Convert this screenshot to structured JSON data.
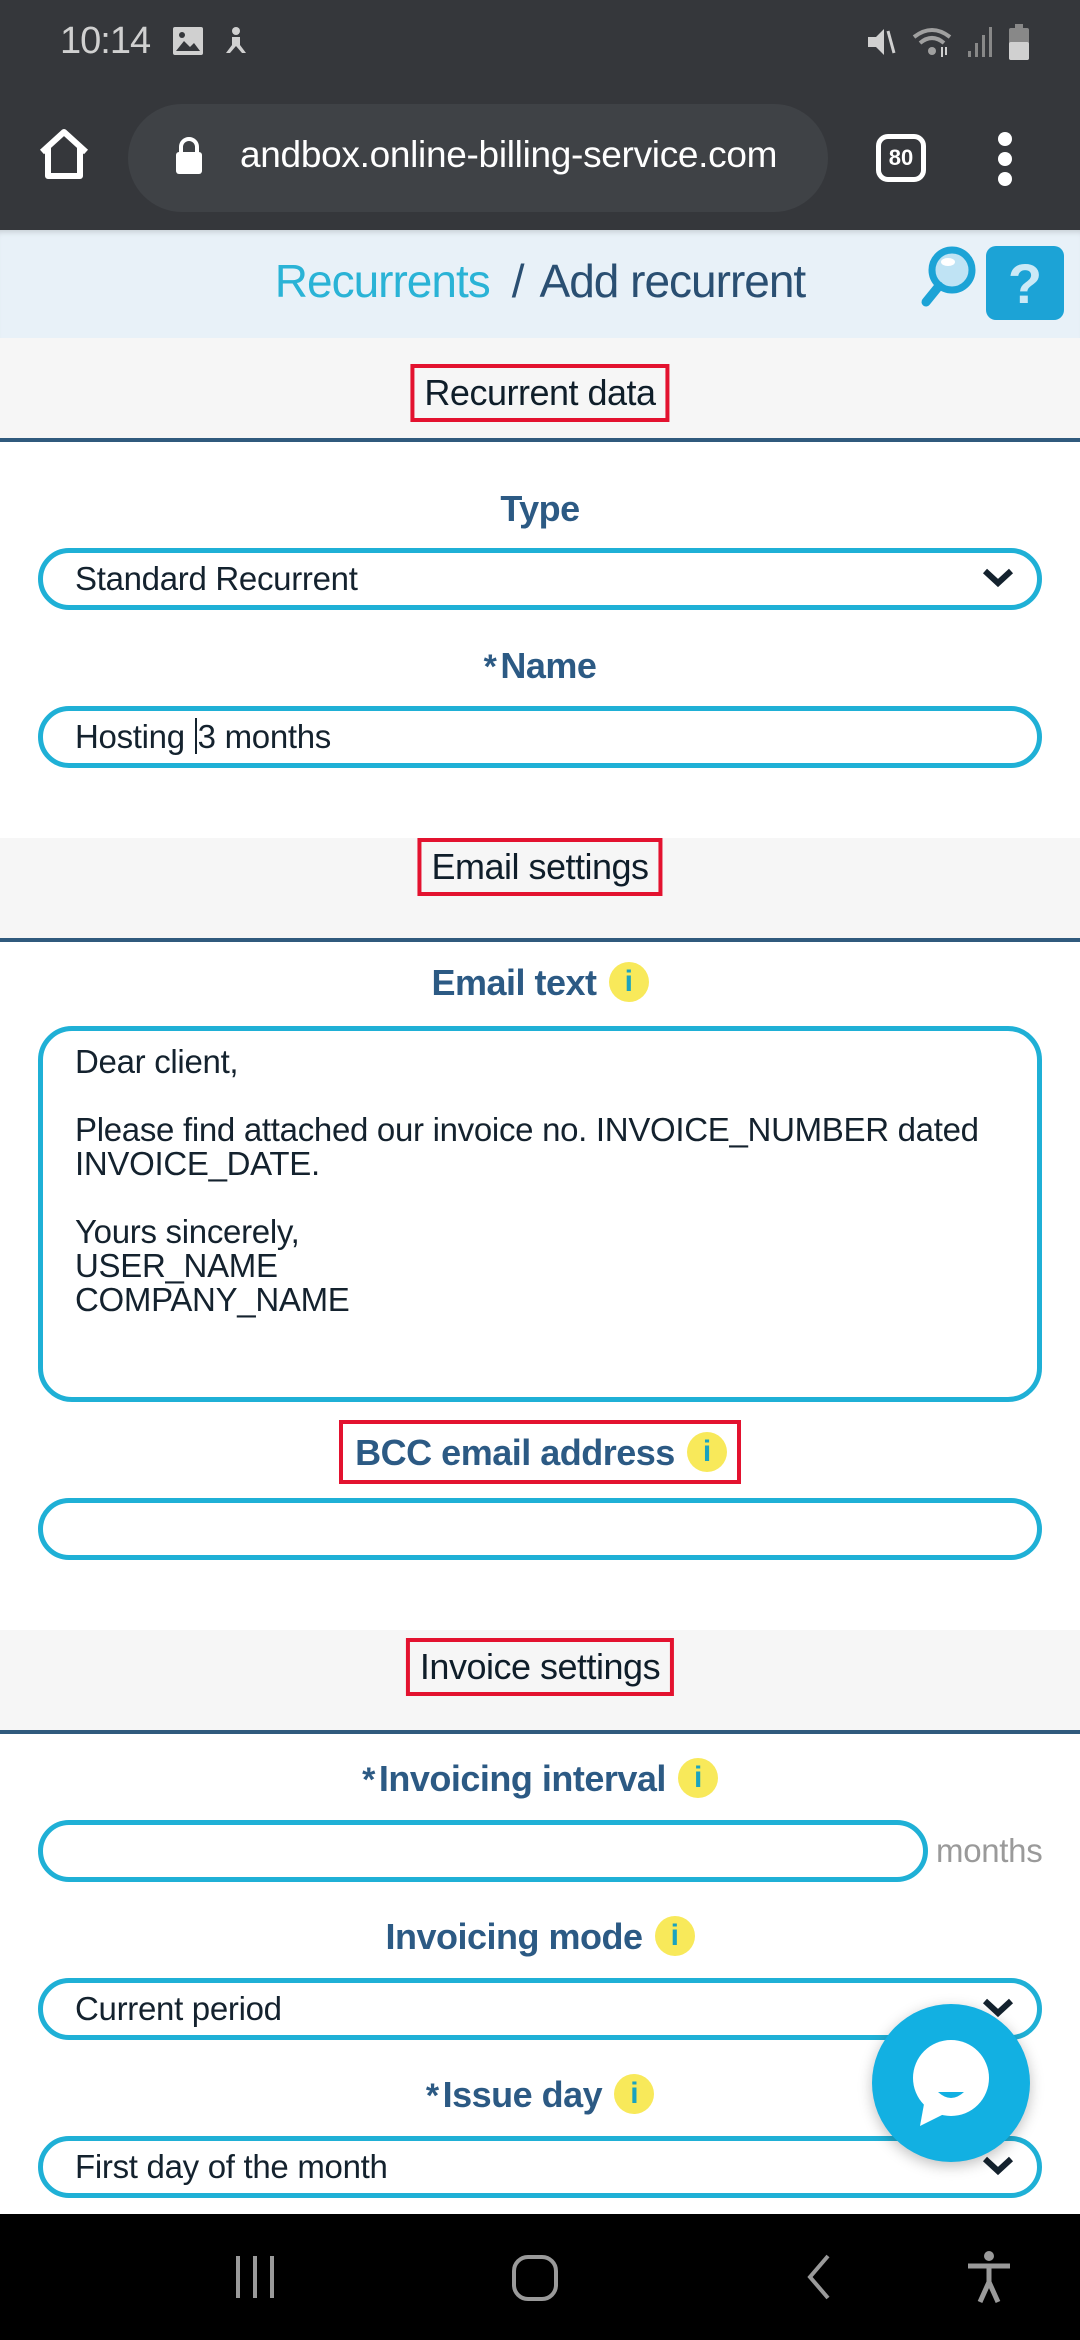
{
  "status_bar": {
    "time": "10:14",
    "left_icons": [
      "gallery-icon",
      "accessibility-person-icon"
    ],
    "right_icons": [
      "vibrate-mute-icon",
      "wifi-icon",
      "signal-icon",
      "battery-icon"
    ]
  },
  "browser": {
    "url": "andbox.online-billing-service.com",
    "tab_count": "80",
    "home_icon": "home-icon",
    "lock_icon": "lock-icon",
    "menu_icon": "more-vert-icon"
  },
  "header": {
    "breadcrumb_parent": "Recurrents",
    "breadcrumb_separator": "/",
    "breadcrumb_current": "Add recurrent",
    "search_icon": "search-icon",
    "help_label": "?"
  },
  "sections": {
    "recurrent_data": "Recurrent data",
    "email_settings": "Email settings",
    "invoice_settings": "Invoice settings"
  },
  "fields": {
    "type": {
      "label": "Type",
      "value": "Standard Recurrent"
    },
    "name": {
      "required": "*",
      "label": "Name",
      "value_before_caret": "Hosting ",
      "value_after_caret": "3 months"
    },
    "email_text": {
      "label": "Email text",
      "info": "i",
      "value": "Dear client,\n\nPlease find attached our invoice no. INVOICE_NUMBER dated\nINVOICE_DATE.\n\nYours sincerely,\nUSER_NAME\nCOMPANY_NAME"
    },
    "bcc_email": {
      "label": "BCC email address",
      "info": "i",
      "value": ""
    },
    "invoicing_interval": {
      "required": "*",
      "label": "Invoicing interval",
      "info": "i",
      "value": "",
      "suffix": "months"
    },
    "invoicing_mode": {
      "label": "Invoicing mode",
      "info": "i",
      "value": "Current period"
    },
    "issue_day": {
      "required": "*",
      "label": "Issue day",
      "info": "i",
      "value": "First day of the month"
    }
  },
  "chat": {
    "icon": "chat-bubble-icon"
  },
  "navbar": {
    "buttons": [
      "recent-apps-icon",
      "home-circle-icon",
      "back-icon",
      "accessibility-icon"
    ]
  },
  "colors": {
    "accent": "#1fb0d6",
    "label": "#2c5a84",
    "highlight_box": "#e3122f",
    "info_badge": "#f8e95a",
    "chat_fab": "#12b0e2"
  }
}
